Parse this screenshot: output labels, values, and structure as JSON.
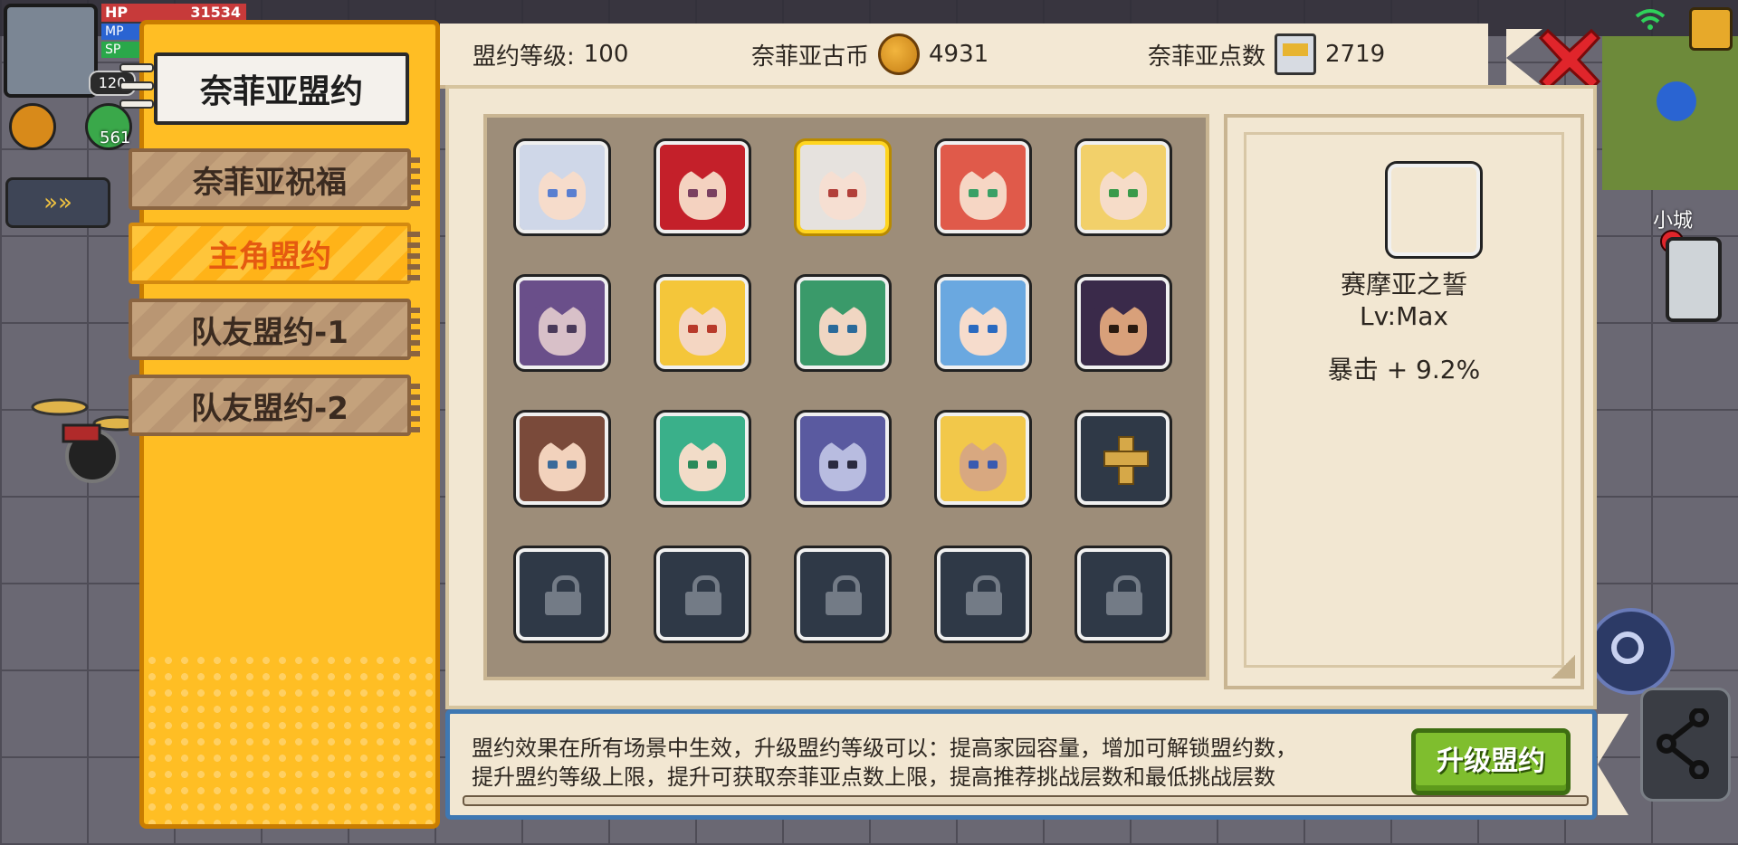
{
  "hud": {
    "hp_label": "HP",
    "hp_value": "31534",
    "mp_label": "MP",
    "sp_label": "SP",
    "level": "120",
    "skill_count": "561",
    "map_label": "小城"
  },
  "tabs": [
    {
      "label": "奈菲亚盟约"
    },
    {
      "label": "奈菲亚祝福"
    },
    {
      "label": "主角盟约",
      "active": true
    },
    {
      "label": "队友盟约-1"
    },
    {
      "label": "队友盟约-2"
    }
  ],
  "info": {
    "level_label": "盟约等级:",
    "level_value": "100",
    "coin_label": "奈菲亚古币",
    "coin_value": "4931",
    "points_label": "奈菲亚点数",
    "points_value": "2719"
  },
  "grid": {
    "slots": [
      {
        "type": "hero",
        "hair": "#cfd7e8",
        "skin": "#f6dccb",
        "eye": "#5a7fd0"
      },
      {
        "type": "hero",
        "hair": "#c4202a",
        "skin": "#f4d2c0",
        "eye": "#7a4060"
      },
      {
        "type": "hero",
        "hair": "#e6e2de",
        "skin": "#f6dfd2",
        "eye": "#b2403a",
        "selected": true
      },
      {
        "type": "hero",
        "hair": "#e05a4a",
        "skin": "#f6d6c4",
        "eye": "#3aa066"
      },
      {
        "type": "hero",
        "hair": "#f2d06a",
        "skin": "#f6dcc8",
        "eye": "#3a9a4a"
      },
      {
        "type": "hero",
        "hair": "#6a4f8a",
        "skin": "#d8c0c8",
        "eye": "#4a3a5a"
      },
      {
        "type": "hero",
        "hair": "#f4c63a",
        "skin": "#f4d6c2",
        "eye": "#b83a2a"
      },
      {
        "type": "hero",
        "hair": "#3a9a6a",
        "skin": "#f0d6c2",
        "eye": "#2a6a9a"
      },
      {
        "type": "hero",
        "hair": "#6aa8e0",
        "skin": "#f6dccc",
        "eye": "#2a6ac0"
      },
      {
        "type": "hero",
        "hair": "#3a2a4a",
        "skin": "#d8a07a",
        "eye": "#2a1a10"
      },
      {
        "type": "hero",
        "hair": "#7a4a3a",
        "skin": "#f2d2bc",
        "eye": "#3a6a9a"
      },
      {
        "type": "hero",
        "hair": "#3ab08a",
        "skin": "#f2dcc8",
        "eye": "#2a8a5a"
      },
      {
        "type": "hero",
        "hair": "#5a5aa0",
        "skin": "#b8bce0",
        "eye": "#2a2a40"
      },
      {
        "type": "hero",
        "hair": "#f2c84a",
        "skin": "#d8a880",
        "eye": "#3a5ab0"
      },
      {
        "type": "add"
      },
      {
        "type": "lock"
      },
      {
        "type": "lock"
      },
      {
        "type": "lock"
      },
      {
        "type": "lock"
      },
      {
        "type": "lock"
      }
    ]
  },
  "detail": {
    "name": "赛摩亚之誓",
    "level": "Lv:Max",
    "bonus": "暴击 + 9.2%",
    "portrait": {
      "hair": "#e6e2de",
      "skin": "#f6dfd2",
      "eye": "#b2403a"
    }
  },
  "description": {
    "line1": "盟约效果在所有场景中生效，升级盟约等级可以：提高家园容量，增加可解锁盟约数，",
    "line2": "提升盟约等级上限，提升可获取奈菲亚点数上限，提高推荐挑战层数和最低挑战层数",
    "button_label": "升级盟约"
  },
  "colors": {
    "accent_orange": "#ffbe24",
    "active_tab_text": "#e55a10",
    "close_red": "#e0252b",
    "upgrade_green": "#7fbe2e",
    "parchment": "#f2e7d2"
  }
}
